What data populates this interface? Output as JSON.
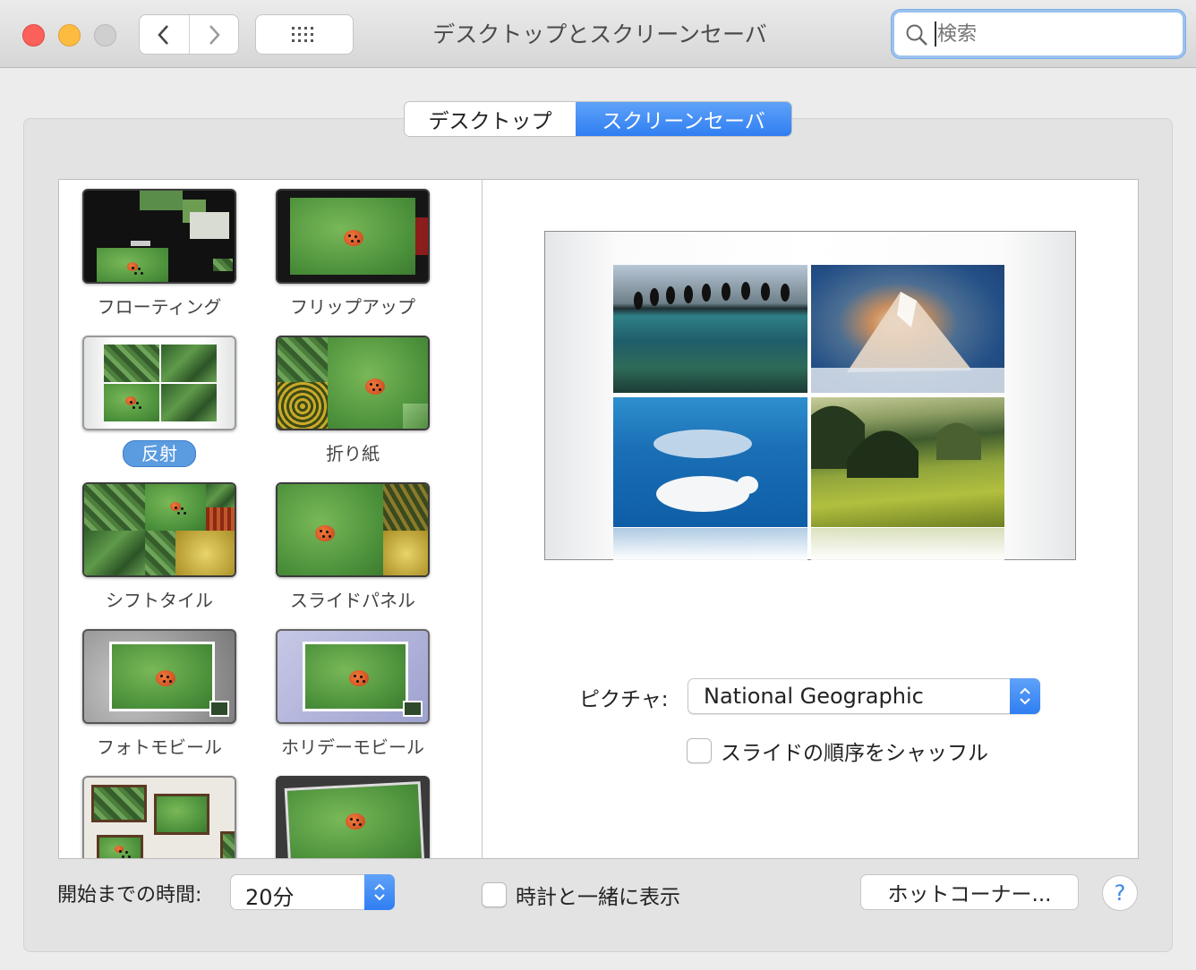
{
  "window": {
    "title": "デスクトップとスクリーンセーバ"
  },
  "search": {
    "placeholder": "検索",
    "icon": "search-icon"
  },
  "toolbar": {
    "back_icon": "chevron-left-icon",
    "forward_icon": "chevron-right-icon",
    "show_all_icon": "grid-icon"
  },
  "tabs": [
    {
      "label": "デスクトップ",
      "selected": false
    },
    {
      "label": "スクリーンセーバ",
      "selected": true
    }
  ],
  "savers": [
    {
      "label": "フローティング",
      "selected": false
    },
    {
      "label": "フリップアップ",
      "selected": false
    },
    {
      "label": "反射",
      "selected": true
    },
    {
      "label": "折り紙",
      "selected": false
    },
    {
      "label": "シフトタイル",
      "selected": false
    },
    {
      "label": "スライドパネル",
      "selected": false
    },
    {
      "label": "フォトモビール",
      "selected": false
    },
    {
      "label": "ホリデーモビール",
      "selected": false
    },
    {
      "label": "",
      "selected": false
    },
    {
      "label": "",
      "selected": false
    }
  ],
  "options": {
    "picture_label": "ピクチャ:",
    "picture_value": "National Geographic",
    "shuffle_label": "スライドの順序をシャッフル",
    "shuffle_checked": false
  },
  "bottom": {
    "start_label": "開始までの時間:",
    "start_value": "20分",
    "clock_label": "時計と一緒に表示",
    "clock_checked": false,
    "hot_corners": "ホットコーナー...",
    "help": "?"
  },
  "colors": {
    "accent": "#2f7ef2",
    "selection": "#5b9be0"
  }
}
